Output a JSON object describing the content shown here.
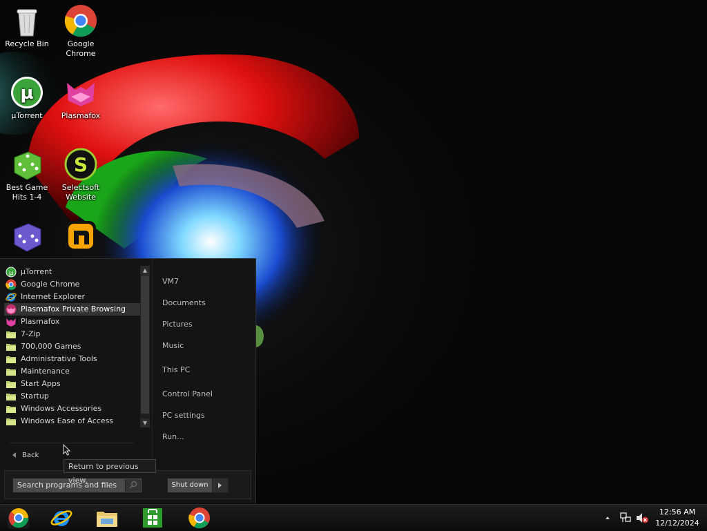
{
  "desktop": {
    "icons": [
      {
        "label": "Recycle Bin",
        "icon": "recycle-bin-icon"
      },
      {
        "label": "Google Chrome",
        "icon": "chrome-icon"
      },
      {
        "label": "µTorrent",
        "icon": "utorrent-icon"
      },
      {
        "label": "Plasmafox",
        "icon": "plasmafox-icon"
      },
      {
        "label": "Best Game Hits 1-4",
        "icon": "green-dice-icon"
      },
      {
        "label": "Selectsoft Website",
        "icon": "selectsoft-icon"
      },
      {
        "label": "",
        "icon": "purple-dice-icon"
      },
      {
        "label": "",
        "icon": "nitro-icon"
      }
    ]
  },
  "start_menu": {
    "programs": [
      {
        "label": "µTorrent",
        "icon": "utorrent-icon"
      },
      {
        "label": "Google Chrome",
        "icon": "chrome-icon"
      },
      {
        "label": "Internet Explorer",
        "icon": "internet-explorer-icon"
      },
      {
        "label": "Plasmafox Private Browsing",
        "icon": "plasmafox-private-icon",
        "highlighted": true
      },
      {
        "label": "Plasmafox",
        "icon": "plasmafox-icon"
      },
      {
        "label": "7-Zip",
        "icon": "folder-icon"
      },
      {
        "label": "700,000 Games",
        "icon": "folder-icon"
      },
      {
        "label": "Administrative Tools",
        "icon": "folder-icon"
      },
      {
        "label": "Maintenance",
        "icon": "folder-icon"
      },
      {
        "label": "Start Apps",
        "icon": "folder-icon"
      },
      {
        "label": "Startup",
        "icon": "folder-icon"
      },
      {
        "label": "Windows Accessories",
        "icon": "folder-icon"
      },
      {
        "label": "Windows Ease of Access",
        "icon": "folder-icon"
      }
    ],
    "back_label": "Back",
    "places": [
      "VM7",
      "Documents",
      "Pictures",
      "Music",
      "This PC",
      "Control Panel",
      "PC settings",
      "Run..."
    ],
    "search_placeholder": "Search programs and files",
    "shutdown_label": "Shut down",
    "tooltip": "Return to previous view."
  },
  "taskbar": {
    "pinned": [
      "start-orb-icon",
      "internet-explorer-icon",
      "file-explorer-icon",
      "store-icon",
      "chrome-icon"
    ],
    "tray_icons": [
      "show-hidden-icons-icon",
      "network-icon",
      "volume-muted-icon"
    ],
    "clock_time": "12:56 AM",
    "clock_date": "12/12/2024"
  },
  "colors": {
    "menu_bg": "#141414",
    "highlight": "#333333",
    "taskbar_bg": "#111111"
  }
}
